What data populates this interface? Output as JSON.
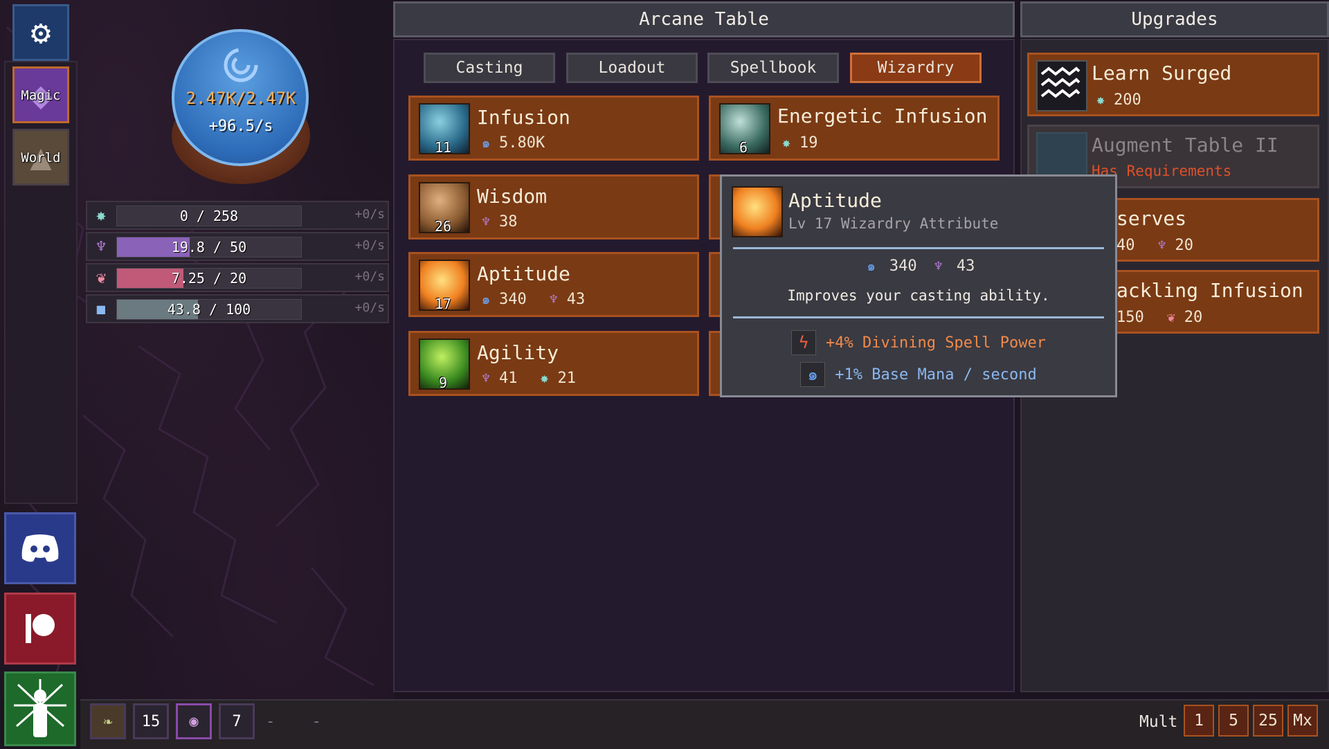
{
  "rail": {
    "magic_label": "Magic",
    "world_label": "World"
  },
  "orb": {
    "mana": "2.47K/2.47K",
    "rate": "+96.5/s"
  },
  "resources": [
    {
      "icon": "star-sigil-icon",
      "value": "0 / 258",
      "rate": "+0/s",
      "fill": 0.0,
      "color": "#5a5860"
    },
    {
      "icon": "lotus-icon",
      "value": "19.8 / 50",
      "rate": "+0/s",
      "fill": 0.396,
      "color": "#8a62b8"
    },
    {
      "icon": "heart-knot-icon",
      "value": "7.25 / 20",
      "rate": "+0/s",
      "fill": 0.3625,
      "color": "#c05a78"
    },
    {
      "icon": "cube-icon",
      "value": "43.8 / 100",
      "rate": "+0/s",
      "fill": 0.438,
      "color": "#6a7a80"
    }
  ],
  "center": {
    "title": "Arcane Table",
    "tabs": [
      "Casting",
      "Loadout",
      "Spellbook",
      "Wizardry"
    ],
    "active_tab": "Wizardry",
    "cards": [
      {
        "name": "Infusion",
        "level": "11",
        "costs": [
          {
            "icon": "mana-swirl-icon",
            "value": "5.80K"
          }
        ]
      },
      {
        "name": "Energetic Infusion",
        "level": "6",
        "costs": [
          {
            "icon": "star-sigil-icon",
            "value": "19"
          }
        ]
      },
      {
        "name": "Wisdom",
        "level": "26",
        "costs": [
          {
            "icon": "lotus-icon",
            "value": "38"
          }
        ]
      },
      {
        "name": "Aptitude",
        "level": "17",
        "costs": [
          {
            "icon": "mana-swirl-icon",
            "value": "340"
          },
          {
            "icon": "lotus-icon",
            "value": "43"
          }
        ]
      },
      {
        "name": "Agility",
        "level": "9",
        "costs": [
          {
            "icon": "lotus-icon",
            "value": "41"
          },
          {
            "icon": "star-sigil-icon",
            "value": "21"
          }
        ]
      }
    ]
  },
  "upgrades": {
    "title": "Upgrades",
    "items": [
      {
        "name": "Learn Surged",
        "cost_icon": "star-sigil-icon",
        "cost": "200"
      },
      {
        "name": "Augment Table II",
        "requirement": "Has Requirements"
      },
      {
        "name": "serves",
        "costs": [
          "40",
          "20"
        ]
      },
      {
        "name": "ackling Infusion",
        "costs": [
          "150",
          "20"
        ]
      }
    ]
  },
  "tooltip": {
    "title": "Aptitude",
    "subtitle": "Lv 17 Wizardry Attribute",
    "cost_mana": "340",
    "cost_lotus": "43",
    "description": "Improves your casting ability.",
    "effects": [
      {
        "icon": "lightning-icon",
        "text": "+4% Divining Spell Power",
        "color": "#f08a4a"
      },
      {
        "icon": "mana-swirl-icon",
        "text": "+1% Base Mana / second",
        "color": "#8ab8f0"
      }
    ]
  },
  "bottom": {
    "slots": [
      "",
      "15",
      "",
      "7"
    ],
    "dots": "- -",
    "mult_label": "Mult",
    "mult_options": [
      "1",
      "5",
      "25",
      "Mx"
    ]
  }
}
